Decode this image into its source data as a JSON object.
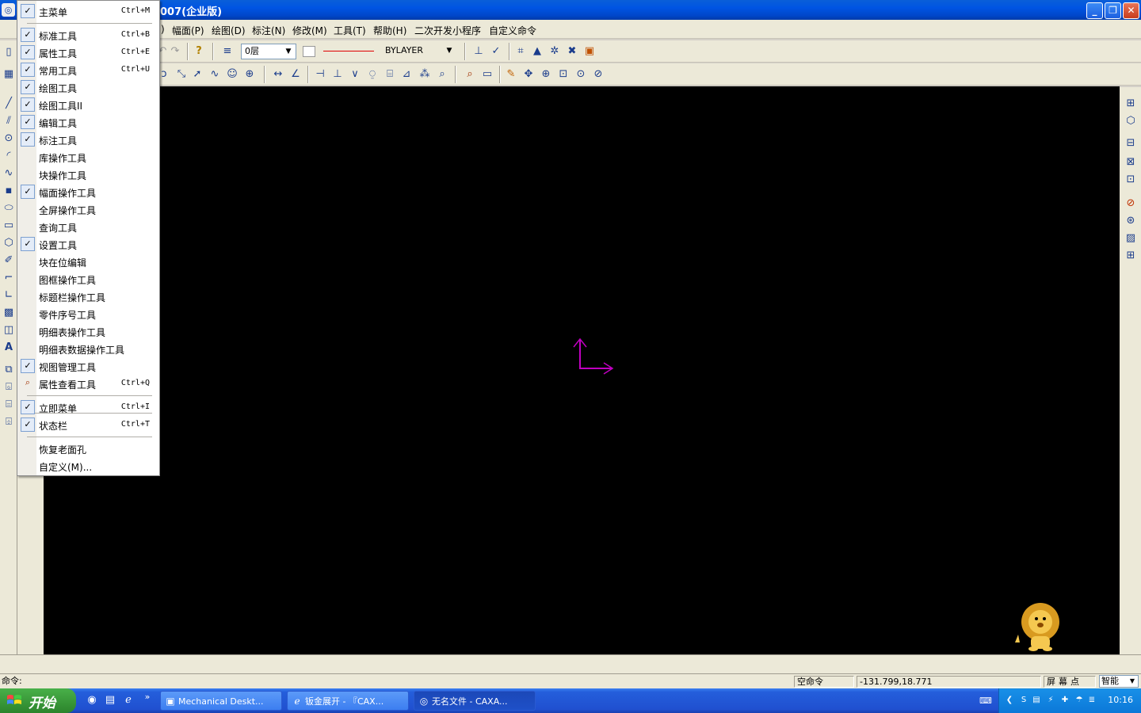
{
  "titlebar": {
    "title": "007(企业版)",
    "min_symbol": "_",
    "restore_symbol": "❐",
    "close_symbol": "✕"
  },
  "menubar": {
    "items": [
      "幅面(P)",
      "绘图(D)",
      "标注(N)",
      "修改(M)",
      "工具(T)",
      "帮助(H)",
      "二次开发小程序",
      "自定义命令"
    ],
    "partial_item": ")"
  },
  "toolbar": {
    "layer_value": "0层",
    "linetype_value": "BYLAYER"
  },
  "popup_menu": {
    "items": [
      {
        "label": "主菜单",
        "checked": true,
        "shortcut": "Ctrl+M"
      },
      {
        "label": "标准工具",
        "checked": true,
        "shortcut": "Ctrl+B"
      },
      {
        "label": "属性工具",
        "checked": true,
        "shortcut": "Ctrl+E"
      },
      {
        "label": "常用工具",
        "checked": true,
        "shortcut": "Ctrl+U"
      },
      {
        "label": "绘图工具",
        "checked": true,
        "shortcut": ""
      },
      {
        "label": "绘图工具II",
        "checked": true,
        "shortcut": ""
      },
      {
        "label": "编辑工具",
        "checked": true,
        "shortcut": ""
      },
      {
        "label": "标注工具",
        "checked": true,
        "shortcut": ""
      },
      {
        "label": "库操作工具",
        "checked": false,
        "shortcut": ""
      },
      {
        "label": "块操作工具",
        "checked": false,
        "shortcut": ""
      },
      {
        "label": "幅面操作工具",
        "checked": true,
        "shortcut": ""
      },
      {
        "label": "全屏操作工具",
        "checked": false,
        "shortcut": ""
      },
      {
        "label": "查询工具",
        "checked": false,
        "shortcut": ""
      },
      {
        "label": "设置工具",
        "checked": true,
        "shortcut": ""
      },
      {
        "label": "块在位编辑",
        "checked": false,
        "shortcut": ""
      },
      {
        "label": "图框操作工具",
        "checked": false,
        "shortcut": ""
      },
      {
        "label": "标题栏操作工具",
        "checked": false,
        "shortcut": ""
      },
      {
        "label": "零件序号工具",
        "checked": false,
        "shortcut": ""
      },
      {
        "label": "明细表操作工具",
        "checked": false,
        "shortcut": ""
      },
      {
        "label": "明细表数据操作工具",
        "checked": false,
        "shortcut": ""
      },
      {
        "label": "视图管理工具",
        "checked": true,
        "shortcut": ""
      },
      {
        "label": "属性查看工具",
        "checked": false,
        "shortcut": "Ctrl+Q",
        "icon": "magnifier-icon"
      },
      {
        "label": "立即菜单",
        "checked": true,
        "shortcut": "Ctrl+I"
      },
      {
        "label": "状态栏",
        "checked": true,
        "shortcut": "Ctrl+T"
      },
      {
        "label": "恢复老面孔",
        "checked": false,
        "shortcut": ""
      },
      {
        "label": "自定义(M)...",
        "checked": false,
        "shortcut": ""
      }
    ],
    "check_symbol": "✓"
  },
  "statusbar": {
    "command_label": "命令:",
    "current_command": "空命令",
    "coordinates": "-131.799,18.771",
    "snap_mode": "屏幕点",
    "smart_select": "智能"
  },
  "taskbar": {
    "start_label": "开始",
    "quicklaunch_more": "»",
    "tasks": [
      {
        "label": "Mechanical Deskt...",
        "active": false
      },
      {
        "label": "钣金展开 - 『CAX...",
        "active": false
      },
      {
        "label": "无名文件 - CAXA...",
        "active": true
      }
    ],
    "clock": "10:16"
  },
  "colors": {
    "canvas": "#000000",
    "ucs": "#c000c0",
    "linetype_line": "#e00000",
    "titlebar": "#0054e3",
    "taskbar": "#245edb"
  }
}
